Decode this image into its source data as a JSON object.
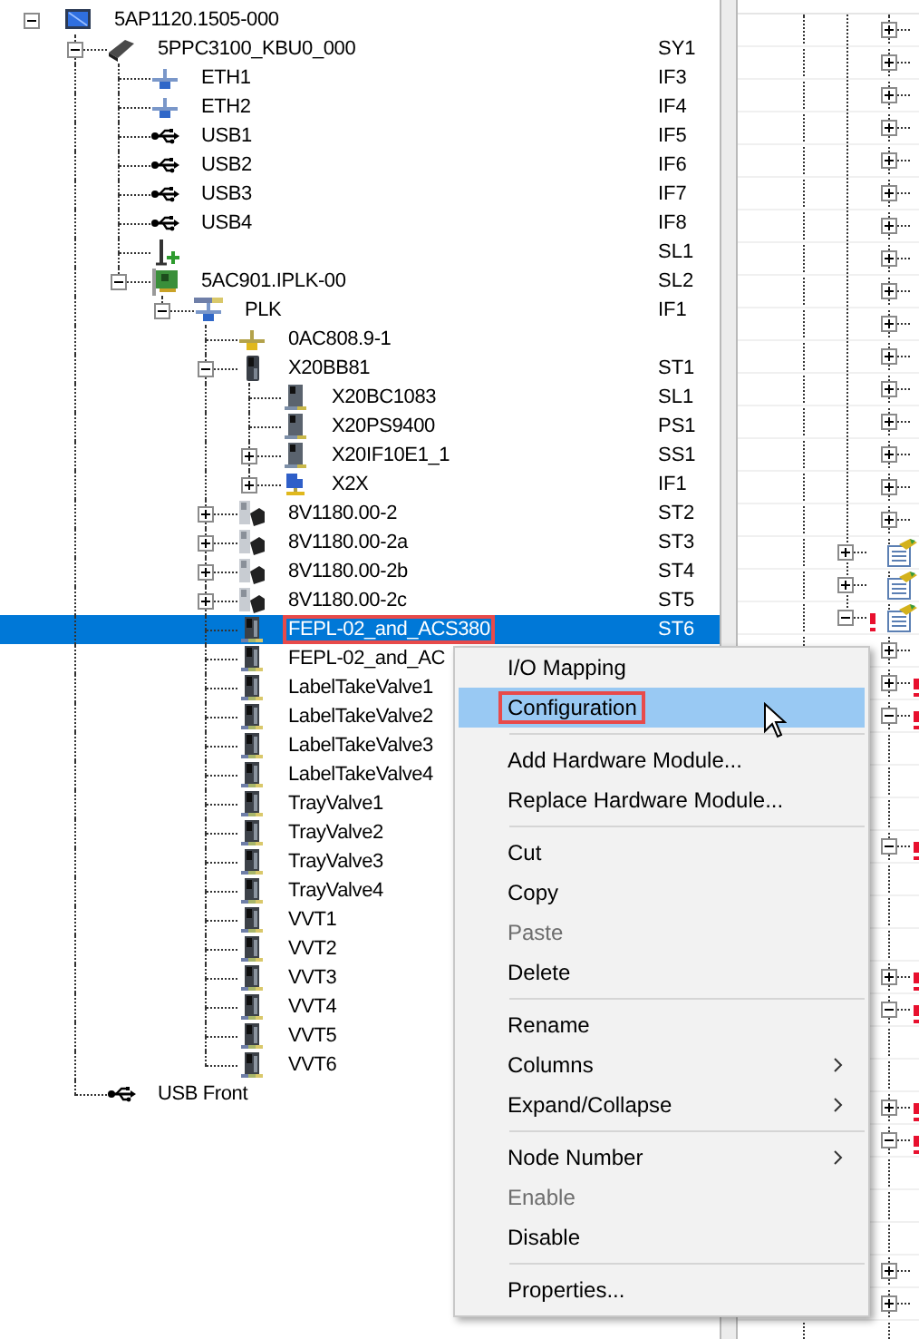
{
  "tree": [
    {
      "label": "5AP1120.1505-000",
      "kind": "monitor",
      "expanded": true,
      "selected": false,
      "annotated": false,
      "children": [
        {
          "label": "5PPC3100_KBU0_000",
          "kind": "controller",
          "position": "SY1",
          "expanded": true,
          "selected": false,
          "annotated": false,
          "children": [
            {
              "label": "ETH1",
              "kind": "ethernet",
              "position": "IF3",
              "selected": false,
              "annotated": false
            },
            {
              "label": "ETH2",
              "kind": "ethernet",
              "position": "IF4",
              "selected": false,
              "annotated": false
            },
            {
              "label": "USB1",
              "kind": "usb",
              "position": "IF5",
              "selected": false,
              "annotated": false
            },
            {
              "label": "USB2",
              "kind": "usb",
              "position": "IF6",
              "selected": false,
              "annotated": false
            },
            {
              "label": "USB3",
              "kind": "usb",
              "position": "IF7",
              "selected": false,
              "annotated": false
            },
            {
              "label": "USB4",
              "kind": "usb",
              "position": "IF8",
              "selected": false,
              "annotated": false
            },
            {
              "kind": "slot",
              "position": "SL1",
              "selected": false
            },
            {
              "label": "5AC901.IPLK-00",
              "kind": "card",
              "position": "SL2",
              "expanded": true,
              "selected": false,
              "annotated": false,
              "children": [
                {
                  "label": "PLK",
                  "kind": "network",
                  "position": "IF1",
                  "expanded": true,
                  "selected": false,
                  "annotated": false,
                  "children": [
                    {
                      "label": "0AC808.9-1",
                      "kind": "terminator",
                      "selected": false,
                      "annotated": false
                    },
                    {
                      "label": "X20BB81",
                      "kind": "bus-module",
                      "position": "ST1",
                      "expanded": true,
                      "selected": false,
                      "annotated": false,
                      "children": [
                        {
                          "label": "X20BC1083",
                          "kind": "io-module",
                          "position": "SL1",
                          "selected": false,
                          "annotated": false
                        },
                        {
                          "label": "X20PS9400",
                          "kind": "io-module",
                          "position": "PS1",
                          "selected": false,
                          "annotated": false
                        },
                        {
                          "label": "X20IF10E1_1",
                          "kind": "io-module",
                          "position": "SS1",
                          "expanded": false,
                          "selected": false,
                          "annotated": false
                        },
                        {
                          "label": "X2X",
                          "kind": "x2x",
                          "position": "IF1",
                          "expanded": false,
                          "selected": false,
                          "annotated": false
                        }
                      ]
                    },
                    {
                      "label": "8V1180.00-2",
                      "kind": "drive",
                      "position": "ST2",
                      "expanded": false,
                      "selected": false,
                      "annotated": false
                    },
                    {
                      "label": "8V1180.00-2a",
                      "kind": "drive",
                      "position": "ST3",
                      "expanded": false,
                      "selected": false,
                      "annotated": false
                    },
                    {
                      "label": "8V1180.00-2b",
                      "kind": "drive",
                      "position": "ST4",
                      "expanded": false,
                      "selected": false,
                      "annotated": false
                    },
                    {
                      "label": "8V1180.00-2c",
                      "kind": "drive",
                      "position": "ST5",
                      "expanded": false,
                      "selected": false,
                      "annotated": false
                    },
                    {
                      "label": "FEPL-02_and_ACS380",
                      "kind": "module",
                      "position": "ST6",
                      "selected": true,
                      "annotated": true
                    },
                    {
                      "label": "FEPL-02_and_AC",
                      "kind": "module",
                      "selected": false,
                      "annotated": false
                    },
                    {
                      "label": "LabelTakeValve1",
                      "kind": "module",
                      "selected": false,
                      "annotated": false
                    },
                    {
                      "label": "LabelTakeValve2",
                      "kind": "module",
                      "selected": false,
                      "annotated": false
                    },
                    {
                      "label": "LabelTakeValve3",
                      "kind": "module",
                      "selected": false,
                      "annotated": false
                    },
                    {
                      "label": "LabelTakeValve4",
                      "kind": "module",
                      "selected": false,
                      "annotated": false
                    },
                    {
                      "label": "TrayValve1",
                      "kind": "module",
                      "selected": false,
                      "annotated": false
                    },
                    {
                      "label": "TrayValve2",
                      "kind": "module",
                      "selected": false,
                      "annotated": false
                    },
                    {
                      "label": "TrayValve3",
                      "kind": "module",
                      "selected": false,
                      "annotated": false
                    },
                    {
                      "label": "TrayValve4",
                      "kind": "module",
                      "selected": false,
                      "annotated": false
                    },
                    {
                      "label": "VVT1",
                      "kind": "module",
                      "selected": false,
                      "annotated": false
                    },
                    {
                      "label": "VVT2",
                      "kind": "module",
                      "selected": false,
                      "annotated": false
                    },
                    {
                      "label": "VVT3",
                      "kind": "module",
                      "selected": false,
                      "annotated": false
                    },
                    {
                      "label": "VVT4",
                      "kind": "module",
                      "selected": false,
                      "annotated": false
                    },
                    {
                      "label": "VVT5",
                      "kind": "module",
                      "selected": false,
                      "annotated": false
                    },
                    {
                      "label": "VVT6",
                      "kind": "module",
                      "selected": false,
                      "annotated": false
                    }
                  ]
                }
              ]
            }
          ]
        },
        {
          "label": "USB Front",
          "kind": "usb",
          "selected": false,
          "annotated": false
        }
      ]
    }
  ],
  "detail_pane": {
    "rows": [
      {
        "kind": "node",
        "expanded": false,
        "warning": false
      },
      {
        "kind": "node",
        "expanded": false,
        "warning": false
      },
      {
        "kind": "node",
        "expanded": false,
        "warning": false
      },
      {
        "kind": "node",
        "expanded": false,
        "warning": false
      },
      {
        "kind": "node",
        "expanded": false,
        "warning": false
      },
      {
        "kind": "node",
        "expanded": false,
        "warning": false
      },
      {
        "kind": "node",
        "expanded": false,
        "warning": false
      },
      {
        "kind": "node",
        "expanded": false,
        "warning": false
      },
      {
        "kind": "node",
        "expanded": false,
        "warning": false
      },
      {
        "kind": "node",
        "expanded": false,
        "warning": false
      },
      {
        "kind": "node",
        "expanded": false,
        "warning": false
      },
      {
        "kind": "node",
        "expanded": false,
        "warning": false
      },
      {
        "kind": "node",
        "expanded": false,
        "warning": false
      },
      {
        "kind": "node",
        "expanded": false,
        "warning": false
      },
      {
        "kind": "node",
        "expanded": false,
        "warning": false
      },
      {
        "kind": "node",
        "expanded": false,
        "warning": false
      },
      {
        "kind": "document",
        "expanded": false,
        "warning": false
      },
      {
        "kind": "document",
        "expanded": false,
        "warning": false
      },
      {
        "kind": "document",
        "expanded": true,
        "warning": true
      },
      {
        "kind": "node",
        "expanded": false,
        "warning": false
      },
      {
        "kind": "node",
        "expanded": false,
        "warning": true
      },
      {
        "kind": "node",
        "expanded": true,
        "warning": true
      },
      {
        "kind": "blank"
      },
      {
        "kind": "blank"
      },
      {
        "kind": "blank"
      },
      {
        "kind": "node",
        "expanded": true,
        "warning": true
      },
      {
        "kind": "blank"
      },
      {
        "kind": "blank"
      },
      {
        "kind": "blank"
      },
      {
        "kind": "node",
        "expanded": false,
        "warning": true
      },
      {
        "kind": "node",
        "expanded": true,
        "warning": true
      },
      {
        "kind": "blank"
      },
      {
        "kind": "blank"
      },
      {
        "kind": "node",
        "expanded": false,
        "warning": true
      },
      {
        "kind": "node",
        "expanded": true,
        "warning": true
      },
      {
        "kind": "blank"
      },
      {
        "kind": "blank"
      },
      {
        "kind": "blank"
      },
      {
        "kind": "node",
        "expanded": false,
        "warning": false
      },
      {
        "kind": "node",
        "expanded": false,
        "warning": false
      }
    ]
  },
  "menu": {
    "items": [
      {
        "kind": "item",
        "label": "I/O Mapping",
        "selected": false,
        "disabled": false,
        "submenu": false,
        "annotated": false
      },
      {
        "kind": "item",
        "label": "Configuration",
        "selected": true,
        "disabled": false,
        "submenu": false,
        "annotated": true
      },
      {
        "kind": "separator"
      },
      {
        "kind": "item",
        "label": "Add Hardware Module...",
        "selected": false,
        "disabled": false,
        "submenu": false,
        "annotated": false
      },
      {
        "kind": "item",
        "label": "Replace Hardware Module...",
        "selected": false,
        "disabled": false,
        "submenu": false,
        "annotated": false
      },
      {
        "kind": "separator"
      },
      {
        "kind": "item",
        "label": "Cut",
        "selected": false,
        "disabled": false,
        "submenu": false,
        "annotated": false
      },
      {
        "kind": "item",
        "label": "Copy",
        "selected": false,
        "disabled": false,
        "submenu": false,
        "annotated": false
      },
      {
        "kind": "item",
        "label": "Paste",
        "selected": false,
        "disabled": true,
        "submenu": false,
        "annotated": false
      },
      {
        "kind": "item",
        "label": "Delete",
        "selected": false,
        "disabled": false,
        "submenu": false,
        "annotated": false
      },
      {
        "kind": "separator"
      },
      {
        "kind": "item",
        "label": "Rename",
        "selected": false,
        "disabled": false,
        "submenu": false,
        "annotated": false
      },
      {
        "kind": "item",
        "label": "Columns",
        "selected": false,
        "disabled": false,
        "submenu": true,
        "annotated": false
      },
      {
        "kind": "item",
        "label": "Expand/Collapse",
        "selected": false,
        "disabled": false,
        "submenu": true,
        "annotated": false
      },
      {
        "kind": "separator"
      },
      {
        "kind": "item",
        "label": "Node Number",
        "selected": false,
        "disabled": false,
        "submenu": true,
        "annotated": false
      },
      {
        "kind": "item",
        "label": "Enable",
        "selected": false,
        "disabled": true,
        "submenu": false,
        "annotated": false
      },
      {
        "kind": "item",
        "label": "Disable",
        "selected": false,
        "disabled": false,
        "submenu": false,
        "annotated": false
      },
      {
        "kind": "separator"
      },
      {
        "kind": "item",
        "label": "Properties...",
        "selected": false,
        "disabled": false,
        "submenu": false,
        "annotated": false
      }
    ]
  }
}
